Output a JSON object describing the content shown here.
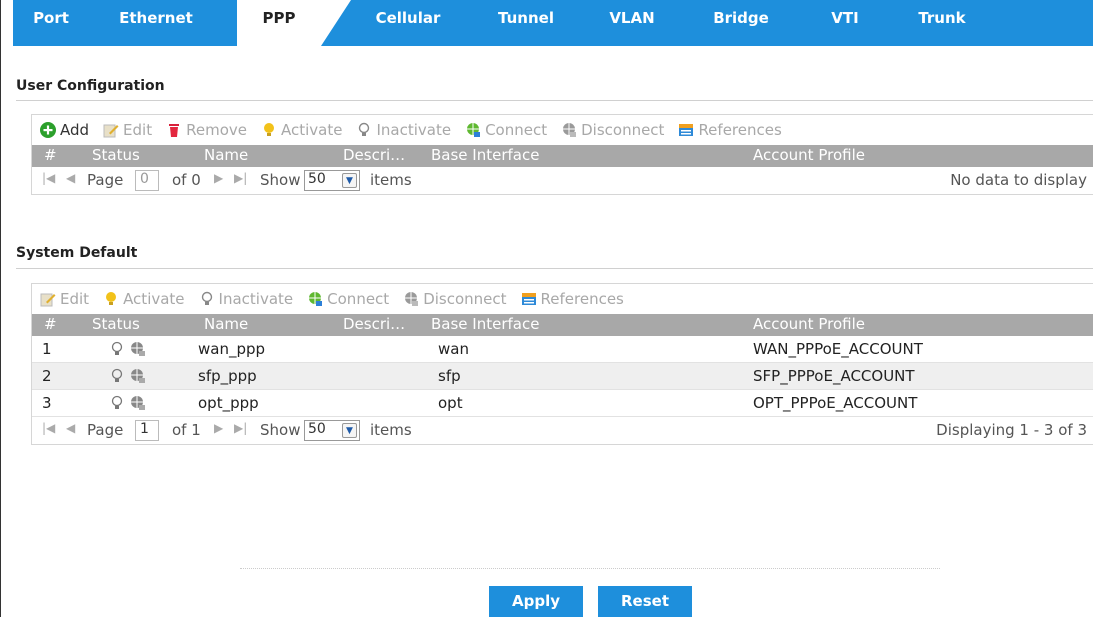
{
  "tabs": [
    "Port",
    "Ethernet",
    "PPP",
    "Cellular",
    "Tunnel",
    "VLAN",
    "Bridge",
    "VTI",
    "Trunk"
  ],
  "active_tab": "PPP",
  "user_config": {
    "title": "User Configuration",
    "toolbar": [
      "Add",
      "Edit",
      "Remove",
      "Activate",
      "Inactivate",
      "Connect",
      "Disconnect",
      "References"
    ],
    "columns": [
      "#",
      "Status",
      "Name",
      "Descri…",
      "Base Interface",
      "Account Profile"
    ],
    "pager": {
      "page_label": "Page",
      "page_value": "0",
      "of": "of 0",
      "show": "Show",
      "per_page": "50",
      "items": "items",
      "info": "No data to display"
    }
  },
  "system_default": {
    "title": "System Default",
    "toolbar": [
      "Edit",
      "Activate",
      "Inactivate",
      "Connect",
      "Disconnect",
      "References"
    ],
    "columns": [
      "#",
      "Status",
      "Name",
      "Descri…",
      "Base Interface",
      "Account Profile"
    ],
    "rows": [
      {
        "num": "1",
        "name": "wan_ppp",
        "base": "wan",
        "profile": "WAN_PPPoE_ACCOUNT"
      },
      {
        "num": "2",
        "name": "sfp_ppp",
        "base": "sfp",
        "profile": "SFP_PPPoE_ACCOUNT"
      },
      {
        "num": "3",
        "name": "opt_ppp",
        "base": "opt",
        "profile": "OPT_PPPoE_ACCOUNT"
      }
    ],
    "pager": {
      "page_label": "Page",
      "page_value": "1",
      "of": "of 1",
      "show": "Show",
      "per_page": "50",
      "items": "items",
      "info": "Displaying 1 - 3 of 3"
    }
  },
  "buttons": {
    "apply": "Apply",
    "reset": "Reset"
  },
  "colors": {
    "accent": "#1e8fdc",
    "header_gray": "#a8a8a8",
    "row_alt": "#efefef"
  },
  "icons": {
    "add": "plus-circle-icon",
    "edit": "pencil-icon",
    "remove": "trash-icon",
    "activate": "bulb-on-icon",
    "inactivate": "bulb-off-icon",
    "connect": "globe-connect-icon",
    "disconnect": "globe-disconnect-icon",
    "references": "references-icon"
  }
}
